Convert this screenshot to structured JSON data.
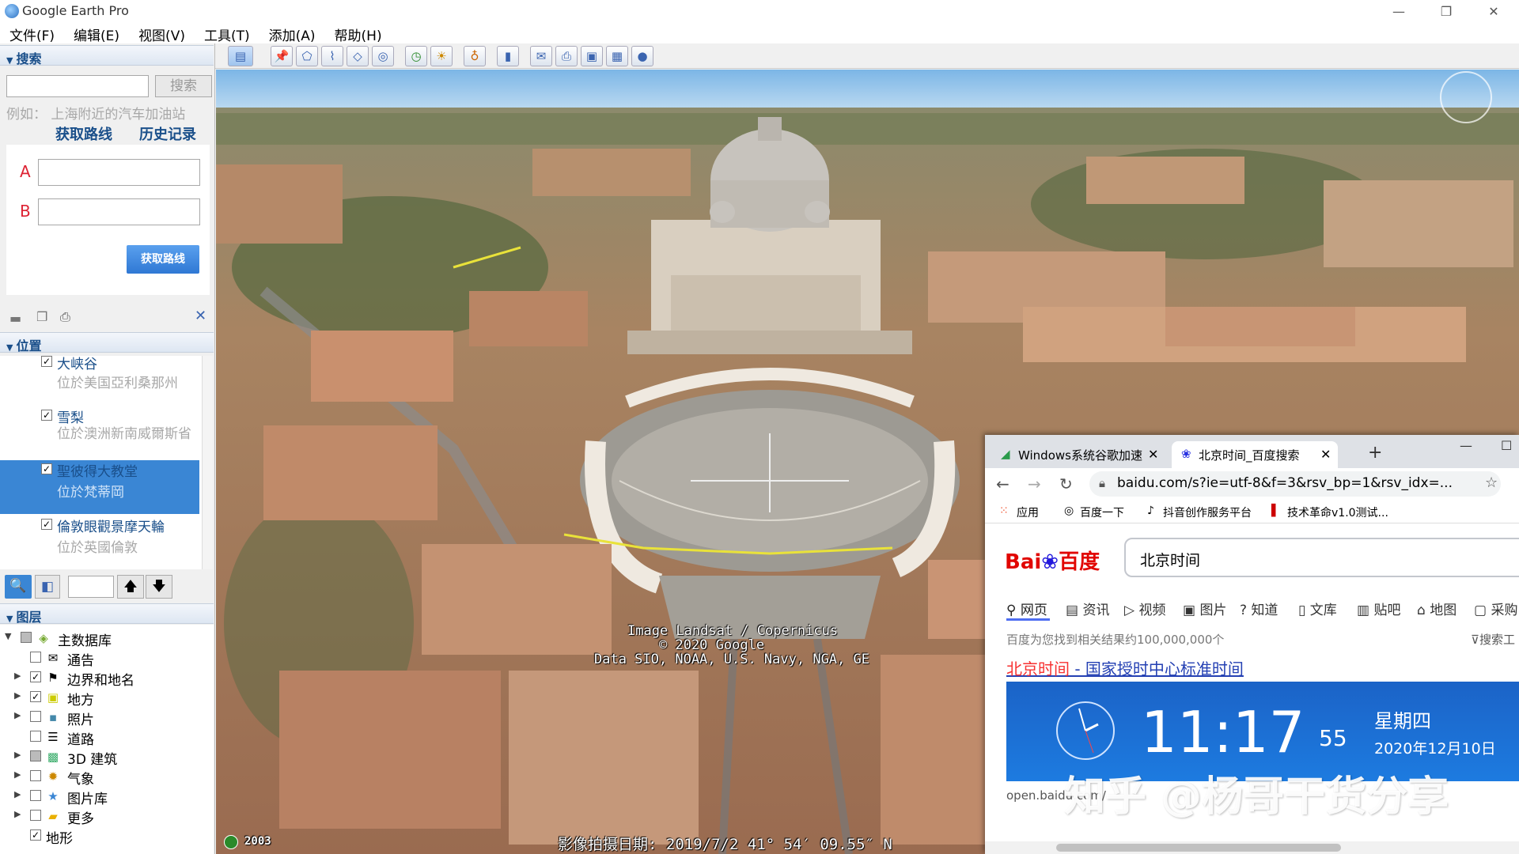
{
  "window": {
    "title": "Google Earth Pro"
  },
  "menu": [
    "文件(F)",
    "编辑(E)",
    "视图(V)",
    "工具(T)",
    "添加(A)",
    "帮助(H)"
  ],
  "search": {
    "header": "搜索",
    "button": "搜索",
    "hint": "例如：  上海附近的汽车加油站",
    "link_route": "获取路线",
    "link_history": "历史记录",
    "label_a": "A",
    "label_b": "B",
    "route_button": "获取路线"
  },
  "places": {
    "header": "位置",
    "items": [
      {
        "name": "大峡谷",
        "location": "位於美国亞利桑那州",
        "checked": true,
        "selected": false
      },
      {
        "name": "雪梨",
        "location": "位於澳洲新南威爾斯省",
        "checked": true,
        "selected": false
      },
      {
        "name": "聖彼得大教堂",
        "location": "位於梵蒂岡",
        "checked": true,
        "selected": true
      },
      {
        "name": "倫敦眼觀景摩天輪",
        "location": "位於英國倫敦",
        "checked": true,
        "selected": false
      }
    ]
  },
  "layers": {
    "header": "图层",
    "items": [
      {
        "label": "主数据库",
        "icon": "database-icon",
        "checked": "partial",
        "expandable": true
      },
      {
        "label": "通告",
        "icon": "envelope-icon",
        "checked": false,
        "expandable": false
      },
      {
        "label": "边界和地名",
        "icon": "flag-icon",
        "checked": true,
        "expandable": true
      },
      {
        "label": "地方",
        "icon": "square-icon",
        "checked": true,
        "expandable": true
      },
      {
        "label": "照片",
        "icon": "photo-icon",
        "checked": false,
        "expandable": true
      },
      {
        "label": "道路",
        "icon": "road-icon",
        "checked": false,
        "expandable": false
      },
      {
        "label": "3D 建筑",
        "icon": "building-icon",
        "checked": "partial",
        "expandable": true
      },
      {
        "label": "气象",
        "icon": "sun-icon",
        "checked": false,
        "expandable": true
      },
      {
        "label": "图片库",
        "icon": "star-icon",
        "checked": false,
        "expandable": true
      },
      {
        "label": "更多",
        "icon": "folder-icon",
        "checked": false,
        "expandable": true
      },
      {
        "label": "地形",
        "icon": "",
        "checked": true,
        "expandable": false
      }
    ]
  },
  "map": {
    "attribution": [
      "Image Landsat / Copernicus",
      "© 2020 Google",
      "Data SIO, NOAA, U.S. Navy, NGA, GE"
    ],
    "year": "2003",
    "status": "影像拍摄日期: 2019/7/2    41° 54′ 09.55″ N"
  },
  "browser": {
    "tab1": "Windows系统谷歌加速",
    "tab2": "北京时间_百度搜索",
    "url": "baidu.com/s?ie=utf-8&f=3&rsv_bp=1&rsv_idx=...",
    "bookmarks": [
      "应用",
      "百度一下",
      "抖音创作服务平台",
      "技术革命v1.0测试..."
    ],
    "logo_text": "Bai",
    "logo_text2": "百度",
    "query": "北京时间",
    "tabs": [
      "网页",
      "资讯",
      "视频",
      "图片",
      "知道",
      "文库",
      "贴吧",
      "地图",
      "采购"
    ],
    "search_tools": "搜索工",
    "result_count": "百度为您找到相关结果约100,000,000个",
    "result_title_red": "北京时间",
    "result_title_rest": " - 国家授时中心标准时间",
    "clock_time": "11:17",
    "clock_seconds": "55",
    "weekday": "星期四",
    "date": "2020年12月10日",
    "result_url": "open.baidu.com/"
  },
  "watermark": "知乎 @杨哥干货分享"
}
